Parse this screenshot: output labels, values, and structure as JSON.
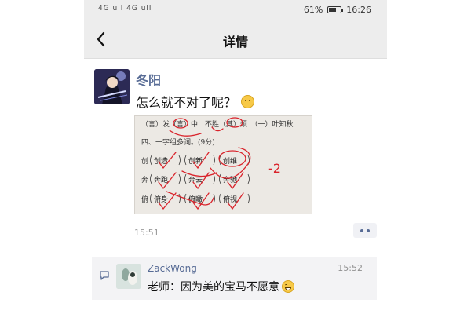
{
  "status_bar": {
    "signal_text": "4G ull 4G ull",
    "battery_percent": "61%",
    "battery_level": 0.61,
    "time": "16:26"
  },
  "nav": {
    "title": "详情",
    "back_icon": "chevron-left-icon"
  },
  "post": {
    "author": "冬阳",
    "text": "怎么就不对了呢？",
    "time": "15:51",
    "photo": {
      "row1": [
        "（",
        "言",
        "）",
        "发",
        "（",
        "言",
        "）",
        "中",
        "不",
        "胜",
        "（",
        "其",
        "）",
        "烦",
        "（一）叶知秋"
      ],
      "row1_text": "（言）发（言）中　不胜（其）烦　（一）叶知秋",
      "section": "四、一字组多词。(9分)",
      "rows": [
        {
          "char": "创",
          "answers": [
            "创造",
            "创新",
            "创维"
          ]
        },
        {
          "char": "奔",
          "answers": [
            "奔跑",
            "奔去",
            "奔驰"
          ]
        },
        {
          "char": "俯",
          "answers": [
            "俯身",
            "俯瞰",
            "俯视"
          ]
        }
      ],
      "score_mark": "-2"
    }
  },
  "comment": {
    "name": "ZackWong",
    "time": "15:52",
    "text": "老师：因为美的宝马不愿意"
  },
  "colors": {
    "link": "#576b95",
    "nav_bg": "#ededed",
    "red_ink": "#d9232b"
  }
}
